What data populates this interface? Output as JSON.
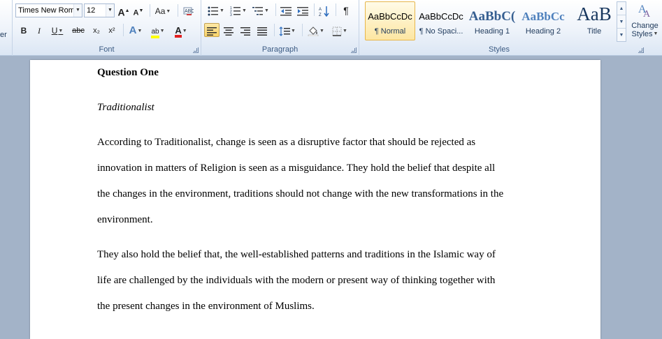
{
  "ribbon": {
    "left_fragment": "er",
    "font": {
      "name": "Times New Rom",
      "size": "12",
      "grow_label": "A",
      "shrink_label": "A",
      "case_label": "Aa",
      "bold": "B",
      "italic": "I",
      "underline": "U",
      "strike": "abc",
      "subscript": "x₂",
      "superscript": "x²",
      "highlight_label": "ab",
      "font_color_label": "A",
      "group_label": "Font"
    },
    "paragraph": {
      "pilcrow": "¶",
      "group_label": "Paragraph"
    },
    "styles": {
      "items": [
        {
          "sample": "AaBbCcDc",
          "name": "¶ Normal"
        },
        {
          "sample": "AaBbCcDc",
          "name": "¶ No Spaci..."
        },
        {
          "sample": "AaBbC(",
          "name": "Heading 1"
        },
        {
          "sample": "AaBbCc",
          "name": "Heading 2"
        },
        {
          "sample": "AaB",
          "name": "Title"
        }
      ],
      "change_styles_line1": "Change",
      "change_styles_line2": "Styles",
      "group_label": "Styles"
    },
    "colors": {
      "highlight": "#ffff00",
      "font_color": "#e02020",
      "heading_blue": "#365f91",
      "heading2_blue": "#4f81bd",
      "title_blue": "#17365d"
    }
  },
  "document": {
    "heading": "Question One",
    "subheading": "Traditionalist",
    "paragraph1": [
      "According to Traditionalist, change is seen as a disruptive factor that should be rejected as",
      "innovation in matters of Religion is seen as a misguidance. They hold the belief that despite all",
      "the changes in the environment, traditions should not change with the new transformations in the",
      "environment."
    ],
    "paragraph2": [
      "They also hold the belief that, the well-established patterns and traditions in the Islamic way of",
      "life are challenged by the individuals with the modern or present way of thinking together with",
      "the present changes in the environment of Muslims."
    ]
  }
}
